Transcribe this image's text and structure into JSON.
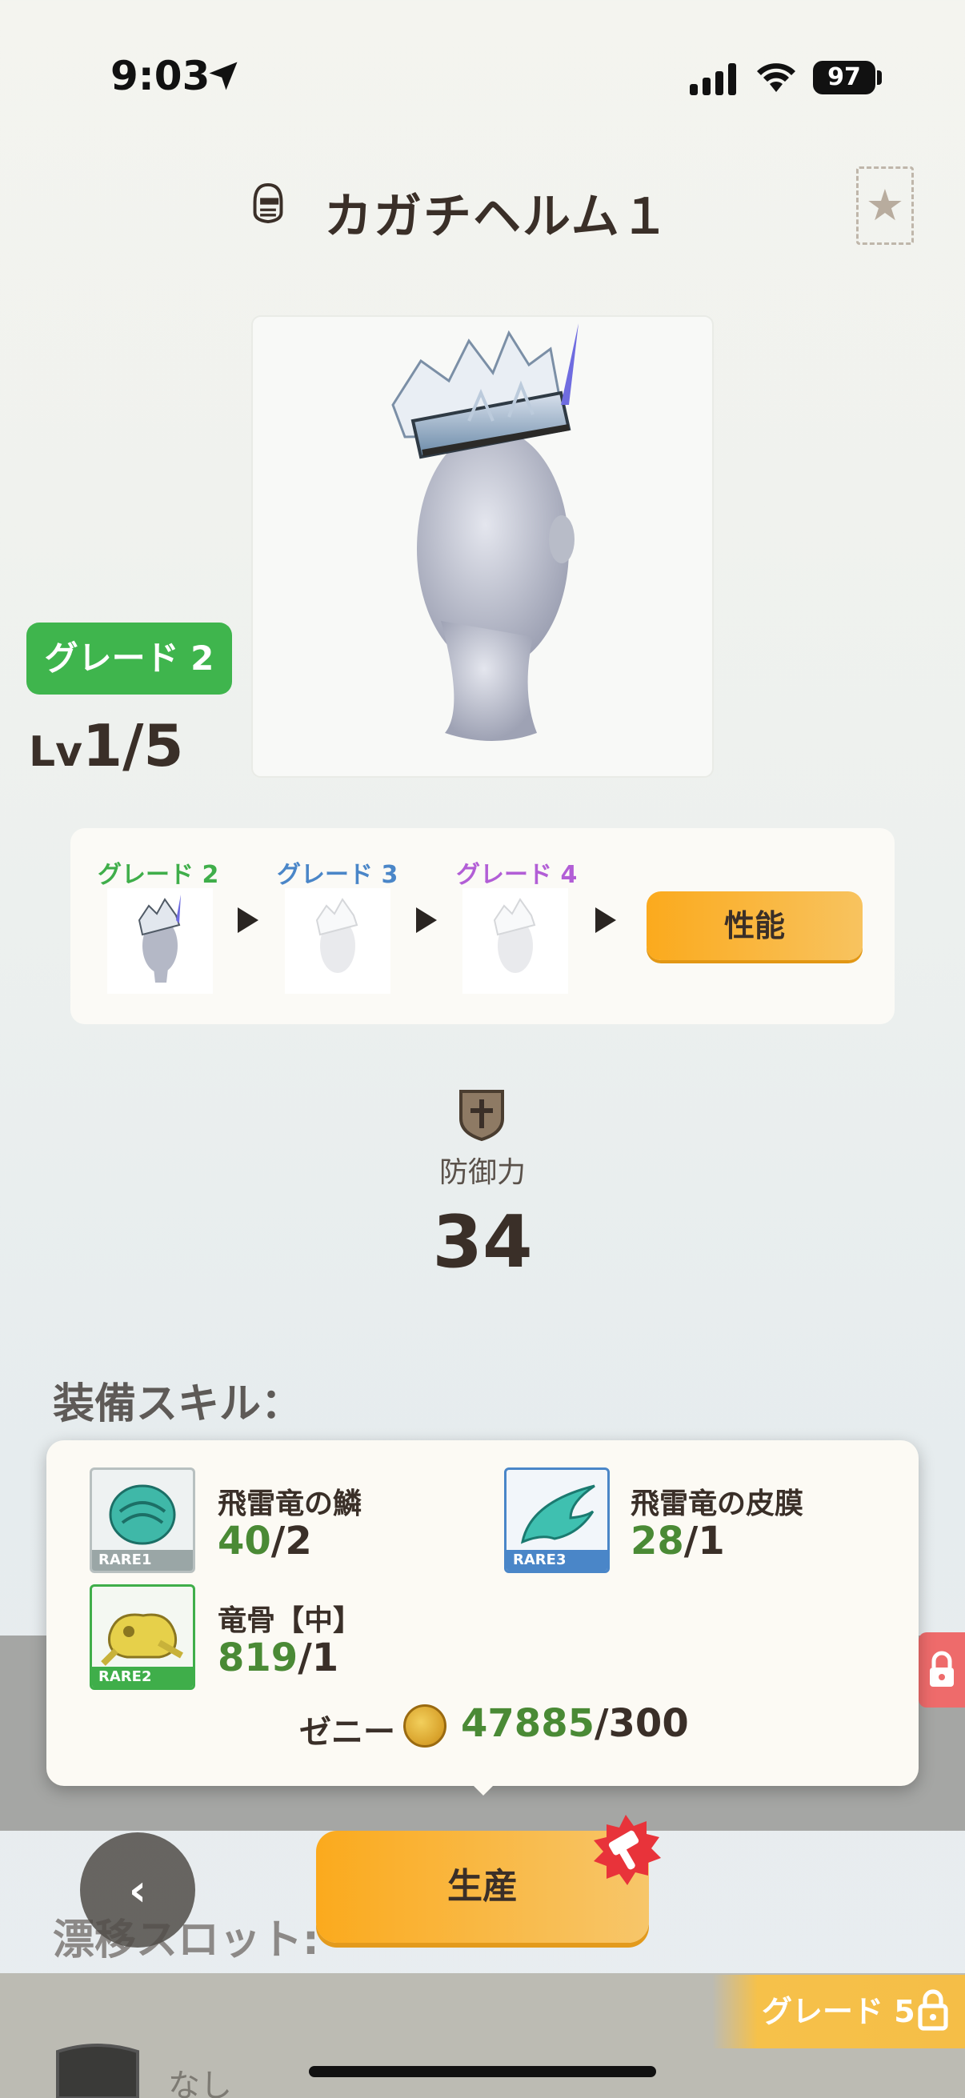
{
  "status_bar": {
    "time": "9:03",
    "battery": "97"
  },
  "header": {
    "title": "カガチヘルム１",
    "icons": [
      "helmet-icon",
      "star-icon"
    ]
  },
  "equipment": {
    "grade_badge": "グレード 2",
    "level_prefix": "Lv",
    "level_value": "1/5"
  },
  "grade_progression": {
    "steps": [
      {
        "label": "グレード 2",
        "color": "#3fae4a"
      },
      {
        "label": "グレード 3",
        "color": "#4a86c8"
      },
      {
        "label": "グレード 4",
        "color": "#b25ed6"
      }
    ],
    "perf_button": "性能"
  },
  "defense": {
    "label": "防御力",
    "value": "34"
  },
  "skills": {
    "title": "装備スキル："
  },
  "materials": {
    "items": [
      {
        "name": "飛雷竜の鱗",
        "have": "40",
        "need": "/2",
        "rarity": "RARE1",
        "rarity_color": "#9aa6a6"
      },
      {
        "name": "飛雷竜の皮膜",
        "have": "28",
        "need": "/1",
        "rarity": "RARE3",
        "rarity_color": "#4a86c8"
      },
      {
        "name": "竜骨【中】",
        "have": "819",
        "need": "/1",
        "rarity": "RARE2",
        "rarity_color": "#3fae4a"
      }
    ],
    "zeny_label": "ゼニー",
    "zeny_have": "47885",
    "zeny_need": "/300"
  },
  "actions": {
    "back": "‹",
    "produce": "生産"
  },
  "drift_slot": {
    "title": "漂移スロット:",
    "grade_lock": "グレード 5",
    "slot_value": "なし"
  }
}
